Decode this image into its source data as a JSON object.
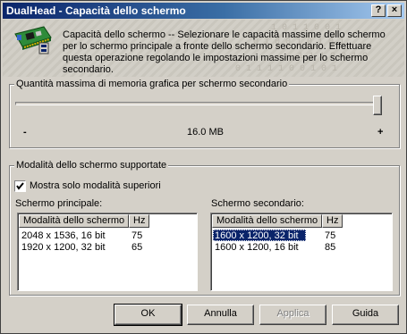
{
  "window": {
    "title": "DualHead - Capacità dello schermo",
    "help_label": "?",
    "close_label": "×"
  },
  "header": {
    "description": "Capacità dello schermo -- Selezionare le capacità massime dello schermo per lo schermo principale a fronte dello schermo secondario. Effettuare questa operazione regolando le impostazioni massime per lo schermo secondario."
  },
  "memory_group": {
    "title": "Quantità massima di memoria grafica per schermo secondario",
    "min_label": "-",
    "max_label": "+",
    "value": "16.0 MB",
    "slider_position_pct": 100
  },
  "modes_group": {
    "title": "Modalità dello schermo supportate",
    "checkbox_label": "Mostra solo modalità superiori",
    "checkbox_checked": true,
    "primary": {
      "label": "Schermo principale:",
      "columns": [
        "Modalità dello schermo",
        "Hz"
      ],
      "rows": [
        {
          "mode": "2048 x 1536, 16 bit",
          "hz": "75"
        },
        {
          "mode": "1920 x 1200, 32 bit",
          "hz": "65"
        }
      ]
    },
    "secondary": {
      "label": "Schermo secondario:",
      "columns": [
        "Modalità dello schermo",
        "Hz"
      ],
      "rows": [
        {
          "mode": "1600 x 1200, 32 bit",
          "hz": "75",
          "selected": true
        },
        {
          "mode": "1600 x 1200, 16 bit",
          "hz": "85"
        }
      ]
    }
  },
  "buttons": {
    "ok": "OK",
    "cancel": "Annulla",
    "apply": "Applica",
    "help": "Guida"
  }
}
